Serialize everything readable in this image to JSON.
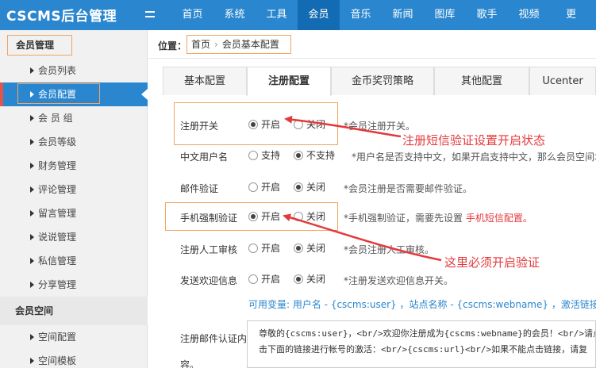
{
  "app": {
    "logo": "CSCMS后台管理"
  },
  "nav": [
    {
      "label": "首页"
    },
    {
      "label": "系统"
    },
    {
      "label": "工具"
    },
    {
      "label": "会员"
    },
    {
      "label": "音乐"
    },
    {
      "label": "新闻"
    },
    {
      "label": "图库"
    },
    {
      "label": "歌手"
    },
    {
      "label": "视频"
    },
    {
      "label": "更"
    }
  ],
  "sidebar": {
    "groups": [
      {
        "label": "会员管理"
      },
      {
        "label": "会员空间"
      }
    ],
    "items": [
      {
        "label": "会员列表"
      },
      {
        "label": "会员配置"
      },
      {
        "label": "会 员 组"
      },
      {
        "label": "会员等级"
      },
      {
        "label": "财务管理"
      },
      {
        "label": "评论管理"
      },
      {
        "label": "留言管理"
      },
      {
        "label": "说说管理"
      },
      {
        "label": "私信管理"
      },
      {
        "label": "分享管理"
      }
    ],
    "space_items": [
      {
        "label": "空间配置"
      },
      {
        "label": "空间模板"
      }
    ]
  },
  "breadcrumb": {
    "label": "位置：",
    "items": [
      {
        "label": "首页"
      },
      {
        "label": "会员基本配置"
      }
    ],
    "separator": "›"
  },
  "tabs": [
    {
      "label": "基本配置"
    },
    {
      "label": "注册配置"
    },
    {
      "label": "金币奖罚策略"
    },
    {
      "label": "其他配置"
    },
    {
      "label": "Ucenter"
    }
  ],
  "form": {
    "rows": [
      {
        "label": "注册开关",
        "options": [
          "开启",
          "关闭"
        ],
        "hint": "*会员注册开关。"
      },
      {
        "label": "中文用户名",
        "options": [
          "支持",
          "不支持"
        ],
        "hint": "*用户名是否支持中文，如果开启支持中文，那么会员空间地"
      },
      {
        "label": "邮件验证",
        "options": [
          "开启",
          "关闭"
        ],
        "hint": "*会员注册是否需要邮件验证。"
      },
      {
        "label": "手机强制验证",
        "options": [
          "开启",
          "关闭"
        ],
        "hint": "*手机强制验证，需要先设置",
        "hint_link": "手机短信配置。"
      },
      {
        "label": "注册人工审核",
        "options": [
          "开启",
          "关闭"
        ],
        "hint": "*会员注册人工审核。"
      },
      {
        "label": "发送欢迎信息",
        "options": [
          "开启",
          "关闭"
        ],
        "hint": "*注册发送欢迎信息开关。"
      }
    ],
    "variables": "可用变量: 用户名 - {cscms:user} ，站点名称 - {cscms:webname} ，激活链接 - {cs",
    "email_label_1": "注册邮件认证内",
    "email_label_2": "容。",
    "email_body": [
      "尊敬的{cscms:user}，<br/>欢迎你注册成为{cscms:webname}的会员！<br/>请点",
      "击下面的链接进行帐号的激活：<br/>{cscms:url}<br/>如果不能点击链接，请复"
    ]
  },
  "annotations": {
    "top": "注册短信验证设置开启状态",
    "bottom": "这里必须开启验证"
  },
  "colors": {
    "primary": "#2a86ce",
    "annotation": "#e4393c",
    "highlight_box": "#f4a460"
  }
}
